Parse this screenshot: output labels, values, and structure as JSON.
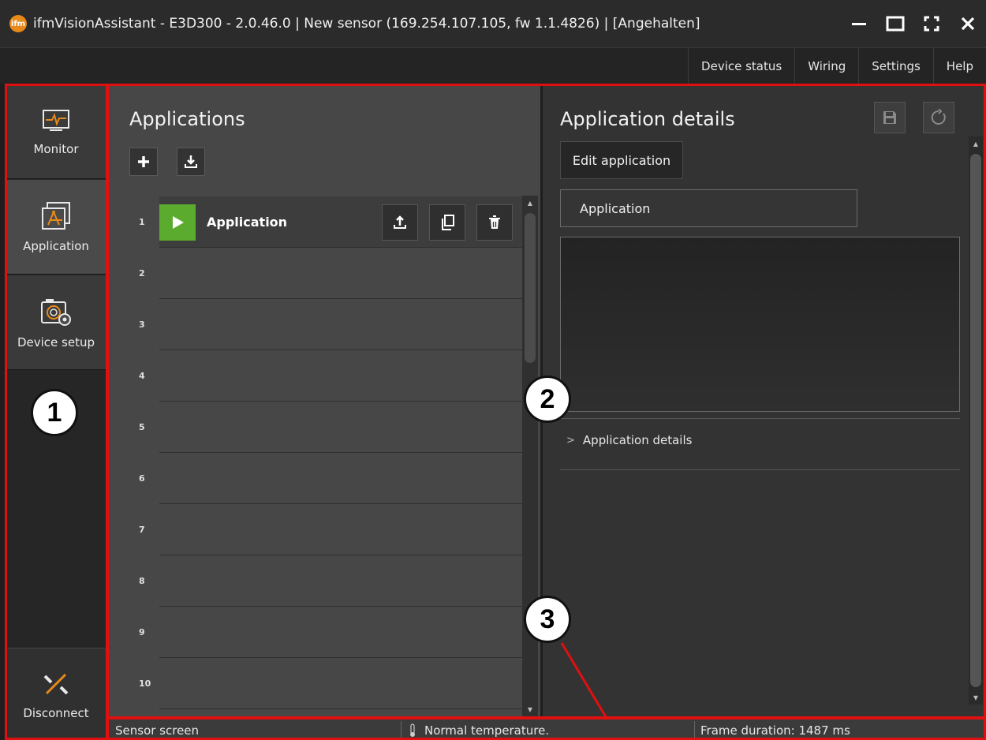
{
  "window": {
    "title": "ifmVisionAssistant - E3D300 - 2.0.46.0 | New sensor (169.254.107.105, fw 1.1.4826) | [Angehalten]",
    "logo_text": "ifm"
  },
  "menu": {
    "items": [
      "Device status",
      "Wiring",
      "Settings",
      "Help"
    ]
  },
  "sidebar": {
    "items": [
      {
        "label": "Monitor",
        "icon": "monitor-icon"
      },
      {
        "label": "Application",
        "icon": "application-icon",
        "selected": true
      },
      {
        "label": "Device setup",
        "icon": "camera-settings-icon"
      }
    ],
    "disconnect_label": "Disconnect"
  },
  "applications": {
    "title": "Applications",
    "rows": [
      {
        "num": "1",
        "name": "Application",
        "active": true
      },
      {
        "num": "2",
        "name": ""
      },
      {
        "num": "3",
        "name": ""
      },
      {
        "num": "4",
        "name": ""
      },
      {
        "num": "5",
        "name": ""
      },
      {
        "num": "6",
        "name": ""
      },
      {
        "num": "7",
        "name": ""
      },
      {
        "num": "8",
        "name": ""
      },
      {
        "num": "9",
        "name": ""
      },
      {
        "num": "10",
        "name": ""
      }
    ]
  },
  "details": {
    "title": "Application details",
    "edit_label": "Edit application",
    "name_value": "Application",
    "expander_label": "Application details"
  },
  "status": {
    "screen": "Sensor screen",
    "temperature": "Normal temperature.",
    "frame": "Frame duration: 1487 ms"
  },
  "callouts": [
    "1",
    "2",
    "3"
  ],
  "colors": {
    "accent_orange": "#e88a1a",
    "play_green": "#5aab2e",
    "callout_frame": "#e01010"
  }
}
